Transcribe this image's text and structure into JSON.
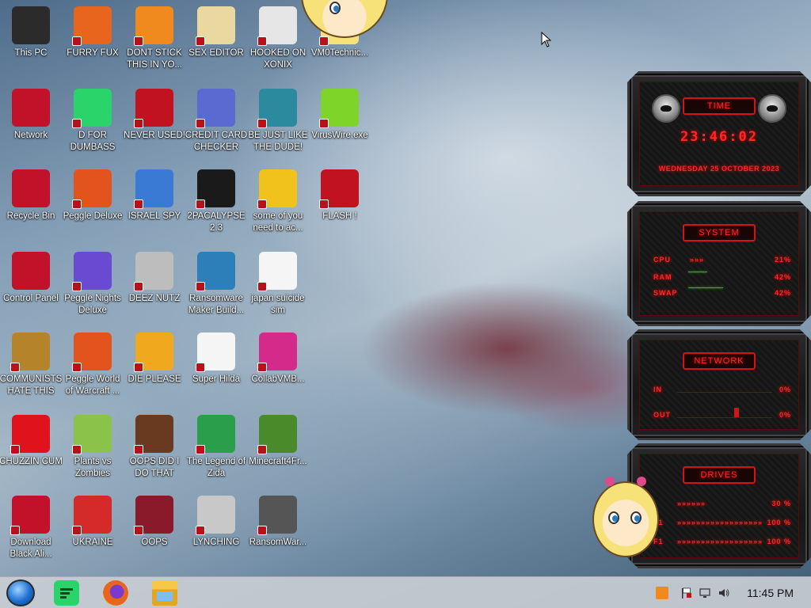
{
  "desktop": {
    "icons": [
      {
        "label": "This PC",
        "icon": "monitor-icon",
        "color": "#2b2b2b"
      },
      {
        "label": "FURRY FUX",
        "icon": "firefox-icon",
        "color": "#e8651e"
      },
      {
        "label": "DONT STICK THIS IN YO...",
        "icon": "traffic-cone-icon",
        "color": "#f08a1e"
      },
      {
        "label": "SEX EDITOR",
        "icon": "hxd-icon",
        "color": "#e9d8a0"
      },
      {
        "label": "HOOKED ON XONIX",
        "icon": "xonix-icon",
        "color": "#e6e6e6"
      },
      {
        "label": "VM0Technic...",
        "icon": "cartoon-icon",
        "color": "#f7e27a"
      },
      {
        "label": "Network",
        "icon": "network-icon",
        "color": "#c2122a"
      },
      {
        "label": "D FOR DUMBASS",
        "icon": "discord-icon",
        "color": "#2bd46a"
      },
      {
        "label": "NEVER USED!",
        "icon": "dev-cpp-icon",
        "color": "#c1121f"
      },
      {
        "label": "CREDIT CARD CHECKER",
        "icon": "credit-card-icon",
        "color": "#5b6ad1"
      },
      {
        "label": "BE JUST LIKE THE DUDE!",
        "icon": "elf-icon",
        "color": "#2c8a9e"
      },
      {
        "label": "VirusWire.exe",
        "icon": "lime-icon",
        "color": "#7fd42a"
      },
      {
        "label": "Recycle Bin",
        "icon": "recycle-bin-icon",
        "color": "#c2122a"
      },
      {
        "label": "Peggle Deluxe",
        "icon": "peggle-icon",
        "color": "#e2531e"
      },
      {
        "label": "ISRAEL SPY",
        "icon": "spy-icon",
        "color": "#3a7ad4"
      },
      {
        "label": "2PACALYPSE 2.3",
        "icon": "terminal-icon",
        "color": "#1a1a1a"
      },
      {
        "label": "some of you need to ac...",
        "icon": "dog-icon",
        "color": "#f1c21b"
      },
      {
        "label": "FLASH !",
        "icon": "flash-icon",
        "color": "#c1121f"
      },
      {
        "label": "Control Panel",
        "icon": "control-panel-icon",
        "color": "#c2122a"
      },
      {
        "label": "Peggle Nights Deluxe",
        "icon": "peggle-nights-icon",
        "color": "#6a4ad1"
      },
      {
        "label": "DEEZ NUTZ",
        "icon": "windows-stack-icon",
        "color": "#bdbdbd"
      },
      {
        "label": "Ransomware Maker Build...",
        "icon": "app-window-icon",
        "color": "#2c7fb8"
      },
      {
        "label": "japan suicide sim",
        "icon": "game-icon",
        "color": "#f5f5f5"
      },
      {
        "label": "COMMUNISTS HATE THIS G...",
        "icon": "money-bag-icon",
        "color": "#b5842a"
      },
      {
        "label": "Peggle World of Warcraft ...",
        "icon": "peggle-wow-icon",
        "color": "#e2531e"
      },
      {
        "label": "DIE PLEASE",
        "icon": "adobe-de-icon",
        "color": "#f0a81e"
      },
      {
        "label": "Super Hilda",
        "icon": "pixel-character-icon",
        "color": "#f5f5f5"
      },
      {
        "label": "CollabVMB...",
        "icon": "collabvm-icon",
        "color": "#d42a8a"
      },
      {
        "label": "CHUZZIN CUM",
        "icon": "chuzzle-icon",
        "color": "#e0121b"
      },
      {
        "label": "Plants vs Zombies",
        "icon": "pvz-icon",
        "color": "#8ac24a"
      },
      {
        "label": "OOPS DID I DO THAT",
        "icon": "portrait-icon",
        "color": "#6a3a20"
      },
      {
        "label": "The Legend of Zida",
        "icon": "zelda-icon",
        "color": "#2a9e4a"
      },
      {
        "label": "Minecraft4Fr...",
        "icon": "grass-block-icon",
        "color": "#4a8a2a"
      },
      {
        "label": "Download Black Ali...",
        "icon": "alienware-icon",
        "color": "#c2122a"
      },
      {
        "label": "UKRAINE",
        "icon": "radiation-icon",
        "color": "#d42a2a"
      },
      {
        "label": "OOPS",
        "icon": "tablet-icon",
        "color": "#8a1a2a"
      },
      {
        "label": "LYNCHING",
        "icon": "gear-flag-icon",
        "color": "#c8c8c8"
      },
      {
        "label": "RansomWar...",
        "icon": "skull-ring-icon",
        "color": "#555555"
      }
    ]
  },
  "widget": {
    "time": {
      "title": "TIME",
      "clock": "23:46:02",
      "date": "WEDNESDAY 25 OCTOBER 2023"
    },
    "system": {
      "title": "SYSTEM",
      "rows": [
        {
          "name": "CPU",
          "value": "21%",
          "arrows": "»»»"
        },
        {
          "name": "RAM",
          "value": "42%",
          "arrows": ""
        },
        {
          "name": "SWAP",
          "value": "42%",
          "arrows": ""
        }
      ]
    },
    "network": {
      "title": "NETWORK",
      "rows": [
        {
          "name": "IN",
          "value": "0%"
        },
        {
          "name": "OUT",
          "value": "0%"
        }
      ]
    },
    "drives": {
      "title": "DRIVES",
      "rows": [
        {
          "name": "",
          "value": "30 %"
        },
        {
          "name": "F1",
          "value": "100 %"
        },
        {
          "name": "F1",
          "value": "100 %"
        }
      ]
    }
  },
  "taskbar": {
    "apps": [
      {
        "icon": "start-orb-icon"
      },
      {
        "icon": "discord-icon",
        "color": "#2bd46a"
      },
      {
        "icon": "firefox-icon",
        "color": "#e8651e"
      },
      {
        "icon": "file-explorer-icon",
        "color": "#f1c21b"
      }
    ],
    "tray": [
      "vlc-tray-icon",
      "flag-tray-icon",
      "network-tray-icon",
      "volume-icon"
    ],
    "clock": "11:45 PM"
  }
}
